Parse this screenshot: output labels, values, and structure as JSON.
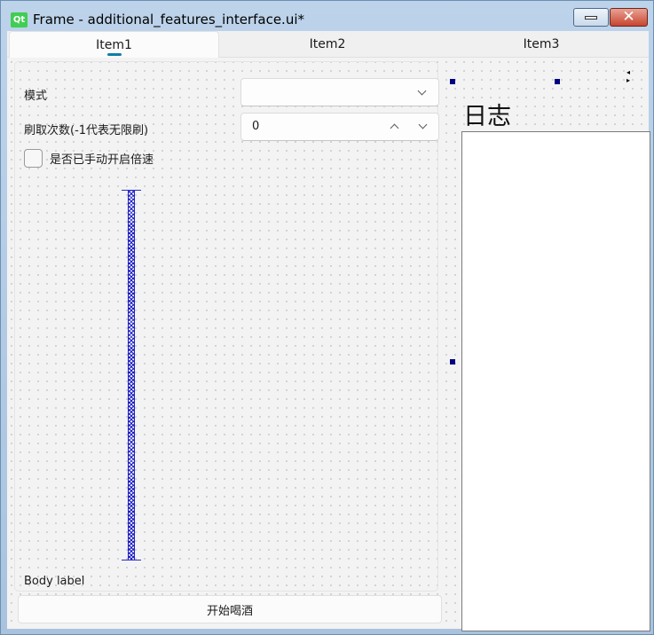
{
  "window": {
    "logo_text": "Qt",
    "title": "Frame - additional_features_interface.ui*",
    "minimize_icon": "minimize-icon",
    "close_icon": "close-icon",
    "close_glyph": "✕"
  },
  "tabs": [
    {
      "label": "Item1",
      "active": true
    },
    {
      "label": "Item2",
      "active": false
    },
    {
      "label": "Item3",
      "active": false
    }
  ],
  "form": {
    "mode_label": "模式",
    "mode_value": "",
    "refresh_label": "刷取次数(-1代表无限刷)",
    "refresh_value": "0",
    "manual_speed_label": "是否已手动开启倍速",
    "manual_speed_checked": false,
    "body_label": "Body label"
  },
  "start_button_label": "开始喝酒",
  "log": {
    "title": "日志",
    "content": "",
    "scroll_arrows": "◂ ▸"
  },
  "colors": {
    "accent": "#0c7fa6",
    "qt_green": "#41cd52",
    "spacer_blue": "#2020c8",
    "handle_navy": "#000080"
  }
}
